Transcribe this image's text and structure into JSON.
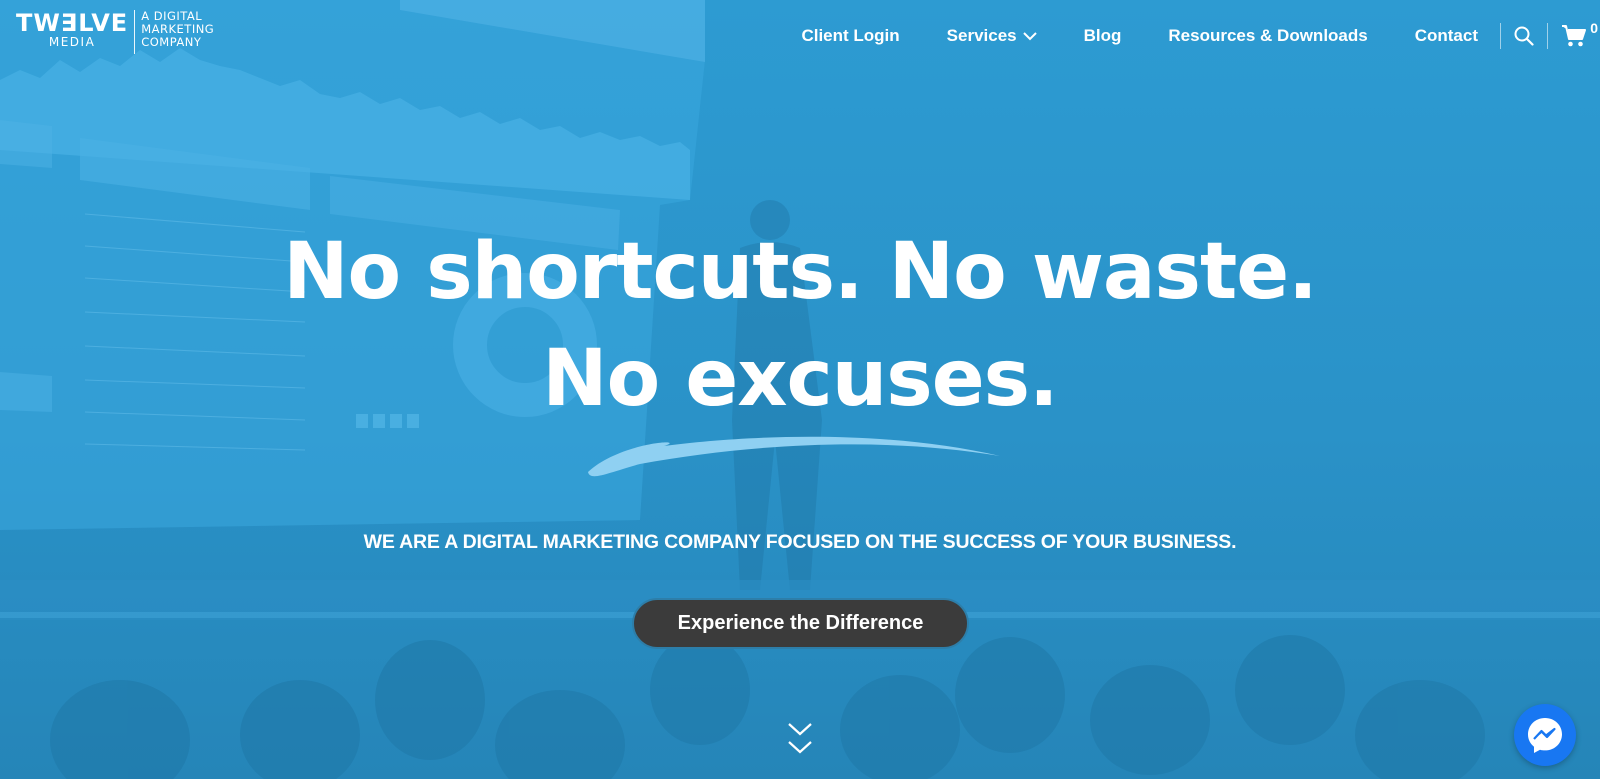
{
  "logo": {
    "word": "TW∃LVE",
    "sub": "MEDIA",
    "tagline_lines": [
      "A DIGITAL",
      "MARKETING",
      "COMPANY"
    ]
  },
  "nav": {
    "items": [
      {
        "label": "Client Login"
      },
      {
        "label": "Services",
        "has_dropdown": true
      },
      {
        "label": "Blog"
      },
      {
        "label": "Resources & Downloads"
      },
      {
        "label": "Contact"
      }
    ],
    "search_icon": "search-icon",
    "cart_icon": "cart-icon",
    "cart_count": "0"
  },
  "hero": {
    "headline_line1": "No shortcuts. No waste.",
    "headline_line2": "No excuses.",
    "tagline": "WE ARE A DIGITAL MARKETING COMPANY FOCUSED ON THE SUCCESS OF YOUR BUSINESS.",
    "cta_label": "Experience the Difference",
    "scroll_icon": "double-chevron-down-icon"
  },
  "chat_widget": {
    "icon": "messenger-icon"
  },
  "colors": {
    "overlay_blue": "#2a92c8",
    "cta_bg": "#3b3b3b",
    "swoosh": "#8fd0f2",
    "messenger": "#1877f2"
  }
}
